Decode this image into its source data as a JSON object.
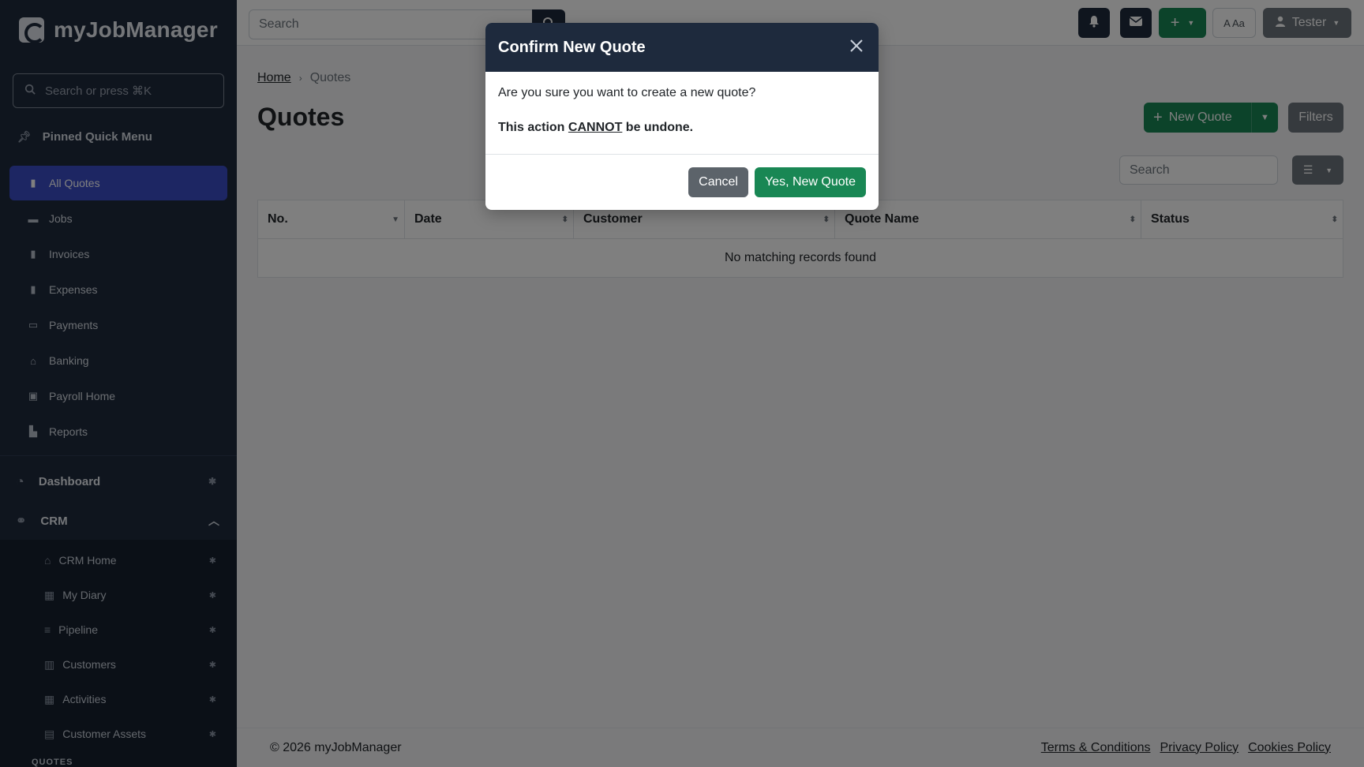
{
  "app": {
    "logo_text": "myJobManager"
  },
  "sidebar": {
    "search_placeholder": "Search or press ⌘K",
    "pinned_label": "Pinned Quick Menu",
    "items": [
      {
        "label": "All Quotes",
        "icon": "file-icon"
      },
      {
        "label": "Jobs",
        "icon": "briefcase-icon"
      },
      {
        "label": "Invoices",
        "icon": "invoice-icon"
      },
      {
        "label": "Expenses",
        "icon": "receipt-icon"
      },
      {
        "label": "Payments",
        "icon": "card-icon"
      },
      {
        "label": "Banking",
        "icon": "bank-icon"
      },
      {
        "label": "Payroll Home",
        "icon": "money-icon"
      },
      {
        "label": "Reports",
        "icon": "chart-icon"
      }
    ],
    "sections": [
      {
        "label": "Dashboard",
        "icon": "gauge-icon"
      },
      {
        "label": "CRM",
        "icon": "handshake-icon"
      }
    ],
    "crm_items": [
      {
        "label": "CRM Home",
        "icon": "home-icon"
      },
      {
        "label": "My Diary",
        "icon": "calendar-icon"
      },
      {
        "label": "Pipeline",
        "icon": "list-icon"
      },
      {
        "label": "Customers",
        "icon": "building-icon"
      },
      {
        "label": "Activities",
        "icon": "calendar-grid-icon"
      },
      {
        "label": "Customer Assets",
        "icon": "assets-icon"
      }
    ],
    "sub_heading": "QUOTES"
  },
  "topbar": {
    "search_placeholder": "Search",
    "font_toggle": "A Aa",
    "user_name": "Tester"
  },
  "main": {
    "breadcrumb_home": "Home",
    "breadcrumb_current": "Quotes",
    "title": "Quotes",
    "new_quote_label": "New Quote",
    "filters_label": "Filters",
    "table_search_placeholder": "Search",
    "columns": [
      "No.",
      "Date",
      "Customer",
      "Quote Name",
      "Status"
    ],
    "empty_message": "No matching records found"
  },
  "footer": {
    "copyright": "© 2026 myJobManager",
    "links": [
      "Terms & Conditions",
      "Privacy Policy",
      "Cookies Policy"
    ]
  },
  "modal": {
    "title": "Confirm New Quote",
    "question": "Are you sure you want to create a new quote?",
    "warn_prefix": "This action ",
    "warn_emphasis": "CANNOT",
    "warn_suffix": " be undone.",
    "cancel_label": "Cancel",
    "confirm_label": "Yes, New Quote"
  },
  "colors": {
    "sidebar_bg": "#1e2a3d",
    "active_item": "#3a4cc6",
    "success": "#198754",
    "secondary": "#6c757d"
  }
}
